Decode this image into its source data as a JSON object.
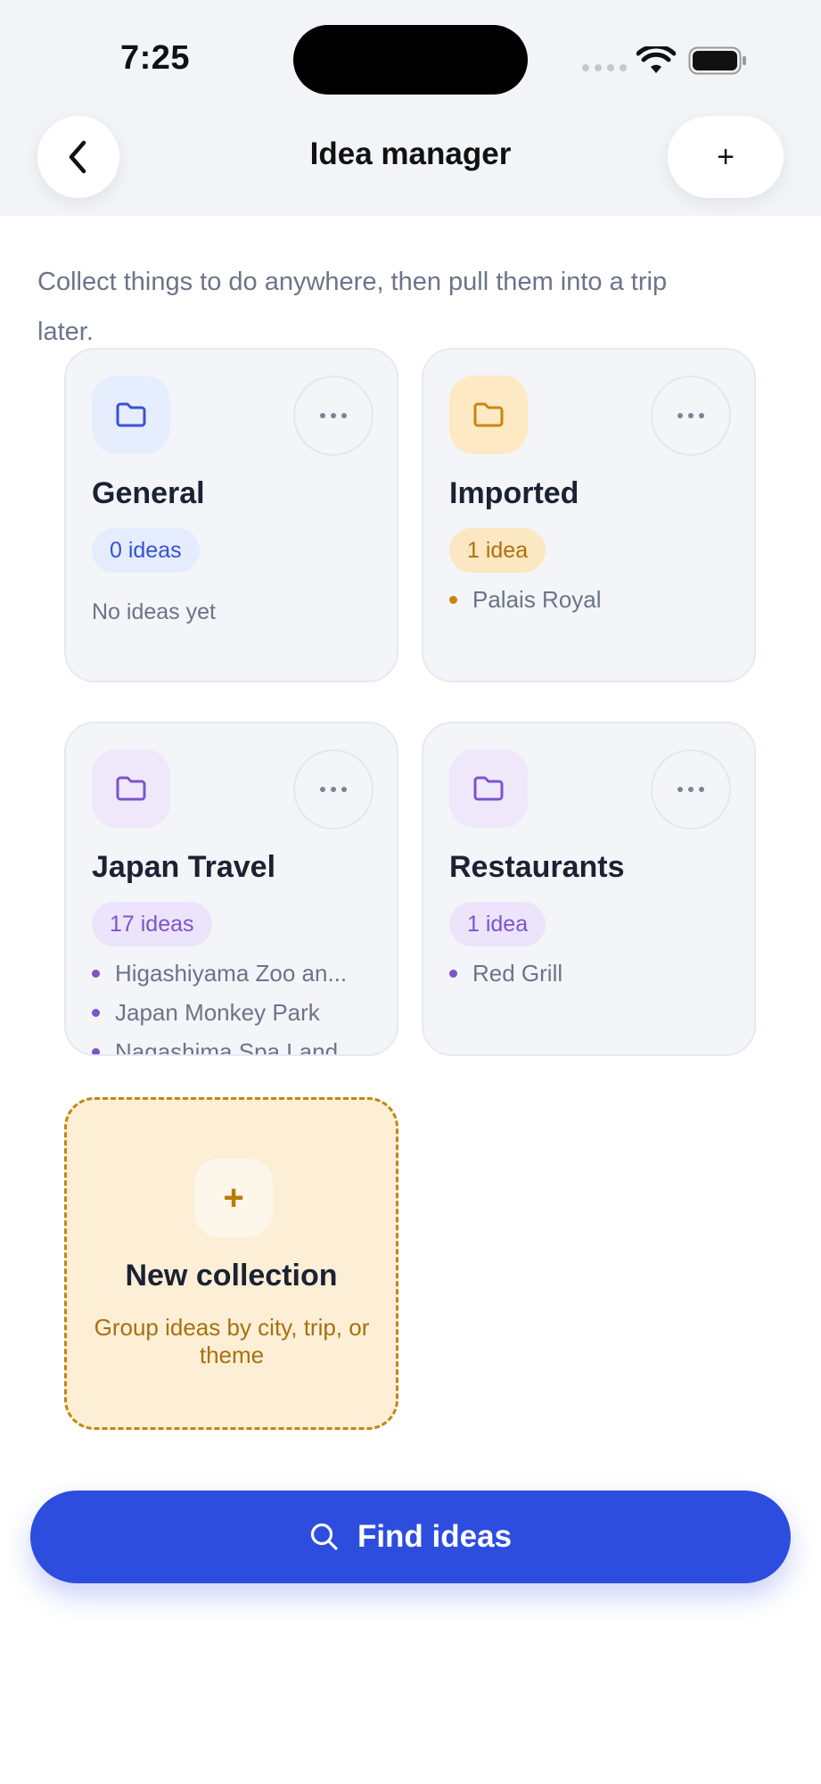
{
  "status_bar": {
    "time": "7:25"
  },
  "header": {
    "title": "Idea manager",
    "add_label": "+"
  },
  "intro": "Collect things to do anywhere, then pull them into a trip later.",
  "collections": [
    {
      "name": "General",
      "count_label": "0 ideas",
      "empty_text": "No ideas yet",
      "items": [],
      "accent": "#3552d6"
    },
    {
      "name": "Imported",
      "count_label": "1 idea",
      "items": [
        "Palais Royal"
      ],
      "accent": "#c8860f"
    },
    {
      "name": "Japan Travel",
      "count_label": "17 ideas",
      "items": [
        "Higashiyama Zoo an...",
        "Japan Monkey Park",
        "Nagashima Spa Land"
      ],
      "accent": "#7a55cc"
    },
    {
      "name": "Restaurants",
      "count_label": "1 idea",
      "items": [
        "Red Grill"
      ],
      "accent": "#7a55cc"
    }
  ],
  "new_collection": {
    "plus": "+",
    "title": "New collection",
    "subtitle": "Group ideas by city, trip, or theme"
  },
  "find_button": {
    "label": "Find ideas",
    "icon": "search-icon"
  }
}
